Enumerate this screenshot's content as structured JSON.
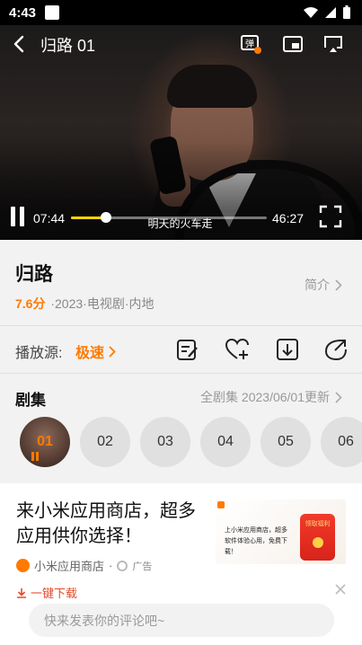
{
  "status_bar": {
    "time": "4:43"
  },
  "player": {
    "title": "归路 01",
    "current_time": "07:44",
    "total_time": "46:27",
    "progress": 0.18,
    "subtitle": "明天的火车走"
  },
  "show": {
    "title": "归路",
    "rating": "7.6分",
    "meta": "·2023·电视剧·内地",
    "intro_label": "简介"
  },
  "source": {
    "label": "播放源:",
    "value": "极速"
  },
  "episodes": {
    "title": "剧集",
    "more_label": "全剧集  2023/06/01更新",
    "items": [
      "01",
      "02",
      "03",
      "04",
      "05",
      "06"
    ]
  },
  "ad": {
    "headline": "来小米应用商店，超多应用供你选择！",
    "app_name": "小米应用商店",
    "badge": "广告",
    "download": "一键下载",
    "image_text": "上小米应用商店，超多软件体验心用，免费下载！",
    "image_button": "领取福利"
  },
  "comment": {
    "placeholder": "快来发表你的评论吧~"
  },
  "colors": {
    "accent": "#ff7a00",
    "progress": "#ffd400",
    "ad_link": "#e34b2a"
  }
}
